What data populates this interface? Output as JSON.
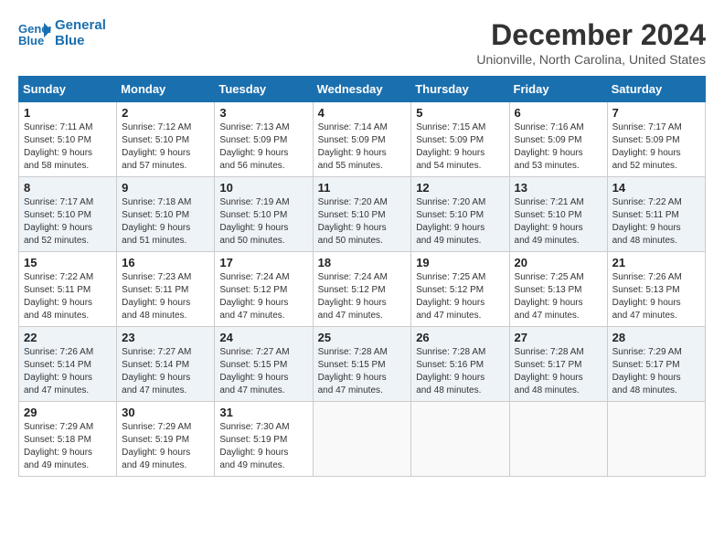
{
  "header": {
    "logo_line1": "General",
    "logo_line2": "Blue",
    "month": "December 2024",
    "location": "Unionville, North Carolina, United States"
  },
  "weekdays": [
    "Sunday",
    "Monday",
    "Tuesday",
    "Wednesday",
    "Thursday",
    "Friday",
    "Saturday"
  ],
  "weeks": [
    [
      {
        "day": "1",
        "sunrise": "7:11 AM",
        "sunset": "5:10 PM",
        "daylight": "9 hours and 58 minutes."
      },
      {
        "day": "2",
        "sunrise": "7:12 AM",
        "sunset": "5:10 PM",
        "daylight": "9 hours and 57 minutes."
      },
      {
        "day": "3",
        "sunrise": "7:13 AM",
        "sunset": "5:09 PM",
        "daylight": "9 hours and 56 minutes."
      },
      {
        "day": "4",
        "sunrise": "7:14 AM",
        "sunset": "5:09 PM",
        "daylight": "9 hours and 55 minutes."
      },
      {
        "day": "5",
        "sunrise": "7:15 AM",
        "sunset": "5:09 PM",
        "daylight": "9 hours and 54 minutes."
      },
      {
        "day": "6",
        "sunrise": "7:16 AM",
        "sunset": "5:09 PM",
        "daylight": "9 hours and 53 minutes."
      },
      {
        "day": "7",
        "sunrise": "7:17 AM",
        "sunset": "5:09 PM",
        "daylight": "9 hours and 52 minutes."
      }
    ],
    [
      {
        "day": "8",
        "sunrise": "7:17 AM",
        "sunset": "5:10 PM",
        "daylight": "9 hours and 52 minutes."
      },
      {
        "day": "9",
        "sunrise": "7:18 AM",
        "sunset": "5:10 PM",
        "daylight": "9 hours and 51 minutes."
      },
      {
        "day": "10",
        "sunrise": "7:19 AM",
        "sunset": "5:10 PM",
        "daylight": "9 hours and 50 minutes."
      },
      {
        "day": "11",
        "sunrise": "7:20 AM",
        "sunset": "5:10 PM",
        "daylight": "9 hours and 50 minutes."
      },
      {
        "day": "12",
        "sunrise": "7:20 AM",
        "sunset": "5:10 PM",
        "daylight": "9 hours and 49 minutes."
      },
      {
        "day": "13",
        "sunrise": "7:21 AM",
        "sunset": "5:10 PM",
        "daylight": "9 hours and 49 minutes."
      },
      {
        "day": "14",
        "sunrise": "7:22 AM",
        "sunset": "5:11 PM",
        "daylight": "9 hours and 48 minutes."
      }
    ],
    [
      {
        "day": "15",
        "sunrise": "7:22 AM",
        "sunset": "5:11 PM",
        "daylight": "9 hours and 48 minutes."
      },
      {
        "day": "16",
        "sunrise": "7:23 AM",
        "sunset": "5:11 PM",
        "daylight": "9 hours and 48 minutes."
      },
      {
        "day": "17",
        "sunrise": "7:24 AM",
        "sunset": "5:12 PM",
        "daylight": "9 hours and 47 minutes."
      },
      {
        "day": "18",
        "sunrise": "7:24 AM",
        "sunset": "5:12 PM",
        "daylight": "9 hours and 47 minutes."
      },
      {
        "day": "19",
        "sunrise": "7:25 AM",
        "sunset": "5:12 PM",
        "daylight": "9 hours and 47 minutes."
      },
      {
        "day": "20",
        "sunrise": "7:25 AM",
        "sunset": "5:13 PM",
        "daylight": "9 hours and 47 minutes."
      },
      {
        "day": "21",
        "sunrise": "7:26 AM",
        "sunset": "5:13 PM",
        "daylight": "9 hours and 47 minutes."
      }
    ],
    [
      {
        "day": "22",
        "sunrise": "7:26 AM",
        "sunset": "5:14 PM",
        "daylight": "9 hours and 47 minutes."
      },
      {
        "day": "23",
        "sunrise": "7:27 AM",
        "sunset": "5:14 PM",
        "daylight": "9 hours and 47 minutes."
      },
      {
        "day": "24",
        "sunrise": "7:27 AM",
        "sunset": "5:15 PM",
        "daylight": "9 hours and 47 minutes."
      },
      {
        "day": "25",
        "sunrise": "7:28 AM",
        "sunset": "5:15 PM",
        "daylight": "9 hours and 47 minutes."
      },
      {
        "day": "26",
        "sunrise": "7:28 AM",
        "sunset": "5:16 PM",
        "daylight": "9 hours and 48 minutes."
      },
      {
        "day": "27",
        "sunrise": "7:28 AM",
        "sunset": "5:17 PM",
        "daylight": "9 hours and 48 minutes."
      },
      {
        "day": "28",
        "sunrise": "7:29 AM",
        "sunset": "5:17 PM",
        "daylight": "9 hours and 48 minutes."
      }
    ],
    [
      {
        "day": "29",
        "sunrise": "7:29 AM",
        "sunset": "5:18 PM",
        "daylight": "9 hours and 49 minutes."
      },
      {
        "day": "30",
        "sunrise": "7:29 AM",
        "sunset": "5:19 PM",
        "daylight": "9 hours and 49 minutes."
      },
      {
        "day": "31",
        "sunrise": "7:30 AM",
        "sunset": "5:19 PM",
        "daylight": "9 hours and 49 minutes."
      },
      null,
      null,
      null,
      null
    ]
  ]
}
